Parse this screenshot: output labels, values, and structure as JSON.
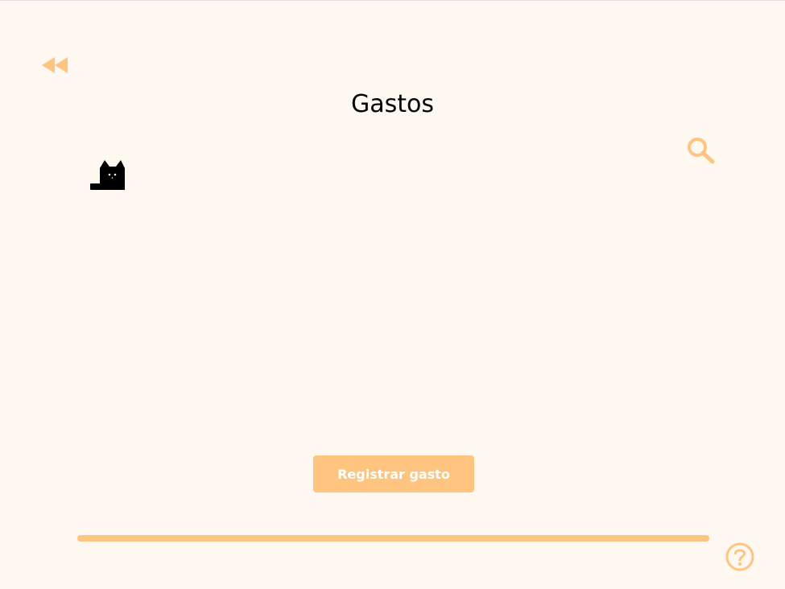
{
  "header": {
    "title": "Gastos",
    "back_icon": "rewind-icon",
    "search_icon": "search-icon"
  },
  "logo": {
    "icon": "cat-icon"
  },
  "actions": {
    "register_label": "Registrar gasto"
  },
  "footer": {
    "progress_fraction": 1.0,
    "help_icon": "help-icon"
  },
  "colors": {
    "background": "#fef8f1",
    "accent": "#ffc47f",
    "title": "#000000",
    "button_text": "#ffffff"
  }
}
